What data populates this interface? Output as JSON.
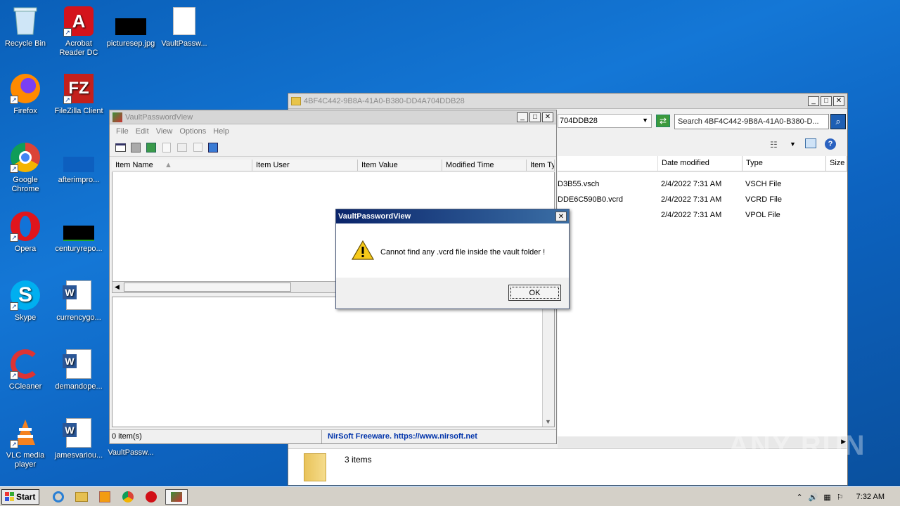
{
  "desktop": {
    "icons": [
      {
        "label": "Recycle Bin"
      },
      {
        "label": "Acrobat Reader DC"
      },
      {
        "label": "picturesep.jpg"
      },
      {
        "label": "VaultPassw..."
      },
      {
        "label": "Firefox"
      },
      {
        "label": "FileZilla Client"
      },
      {
        "label": "Google Chrome"
      },
      {
        "label": "afterimpro..."
      },
      {
        "label": "Opera"
      },
      {
        "label": "centuryrepo..."
      },
      {
        "label": "Skype"
      },
      {
        "label": "currencygo..."
      },
      {
        "label": "CCleaner"
      },
      {
        "label": "demandope..."
      },
      {
        "label": "VLC media player"
      },
      {
        "label": "jamesvariou..."
      },
      {
        "label": "VaultPassw..."
      }
    ]
  },
  "explorer": {
    "title": "4BF4C442-9B8A-41A0-B380-DD4A704DDB28",
    "address": "704DDB28",
    "search_placeholder": "Search 4BF4C442-9B8A-41A0-B380-D...",
    "columns": [
      "Date modified",
      "Type",
      "Size"
    ],
    "rows": [
      {
        "name": "D3B55.vsch",
        "date": "2/4/2022 7:31 AM",
        "type": "VSCH File"
      },
      {
        "name": "DDE6C590B0.vcrd",
        "date": "2/4/2022 7:31 AM",
        "type": "VCRD File"
      },
      {
        "name": "",
        "date": "2/4/2022 7:31 AM",
        "type": "VPOL File"
      }
    ],
    "item_count": "3 items"
  },
  "vpv": {
    "title": "VaultPasswordView",
    "menu": [
      "File",
      "Edit",
      "View",
      "Options",
      "Help"
    ],
    "columns": [
      "Item Name",
      "Item User",
      "Item Value",
      "Modified Time",
      "Item Ty"
    ],
    "status_count": "0 item(s)",
    "status_link": "NirSoft Freeware. https://www.nirsoft.net"
  },
  "dialog": {
    "title": "VaultPasswordView",
    "message": "Cannot find any .vcrd file inside the vault folder !",
    "ok": "OK"
  },
  "taskbar": {
    "start": "Start",
    "clock": "7:32 AM"
  },
  "watermark": "ANY RUN"
}
